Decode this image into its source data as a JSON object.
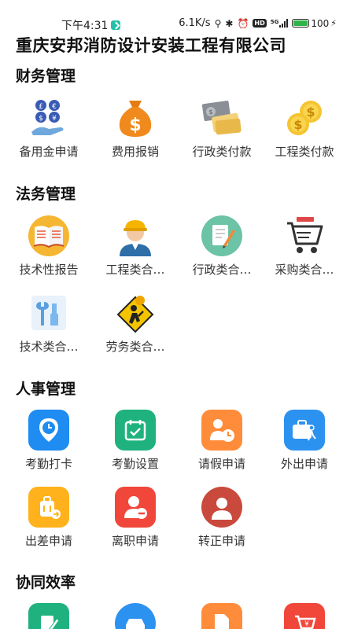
{
  "status_bar": {
    "time": "下午4:31",
    "network_speed": "6.1K/s",
    "hd": "HD",
    "network": "5G",
    "battery": "100"
  },
  "company_name": "重庆安邦消防设计安装工程有限公司",
  "sections": [
    {
      "title": "财务管理",
      "items": [
        {
          "label": "备用金申请",
          "icon": "currency-exchange-icon"
        },
        {
          "label": "费用报销",
          "icon": "money-bag-icon"
        },
        {
          "label": "行政类付款",
          "icon": "cash-cards-icon"
        },
        {
          "label": "工程类付款",
          "icon": "coins-icon"
        }
      ]
    },
    {
      "title": "法务管理",
      "items": [
        {
          "label": "技术性报告",
          "icon": "open-book-icon"
        },
        {
          "label": "工程类合…",
          "icon": "engineer-icon"
        },
        {
          "label": "行政类合…",
          "icon": "document-pencil-icon"
        },
        {
          "label": "采购类合…",
          "icon": "shopping-cart-icon"
        },
        {
          "label": "技术类合…",
          "icon": "tools-icon"
        },
        {
          "label": "劳务类合…",
          "icon": "worker-sign-icon"
        }
      ]
    },
    {
      "title": "人事管理",
      "items": [
        {
          "label": "考勤打卡",
          "icon": "clock-pin-icon"
        },
        {
          "label": "考勤设置",
          "icon": "calendar-check-icon"
        },
        {
          "label": "请假申请",
          "icon": "leave-clock-icon"
        },
        {
          "label": "外出申请",
          "icon": "briefcase-walk-icon"
        },
        {
          "label": "出差申请",
          "icon": "luggage-plane-icon"
        },
        {
          "label": "离职申请",
          "icon": "user-minus-icon"
        },
        {
          "label": "转正申请",
          "icon": "user-silhouette-icon"
        }
      ]
    },
    {
      "title": "协同效率",
      "items": [
        {
          "label": "",
          "icon": "edit-note-icon"
        },
        {
          "label": "",
          "icon": "car-icon"
        },
        {
          "label": "",
          "icon": "file-icon"
        },
        {
          "label": "",
          "icon": "cart-yen-icon"
        }
      ]
    }
  ],
  "colors": {
    "blue": "#1e8cf0",
    "green": "#1fb27e",
    "orange": "#ff8c3a",
    "red": "#f0473a",
    "yellow": "#ffb21c"
  }
}
